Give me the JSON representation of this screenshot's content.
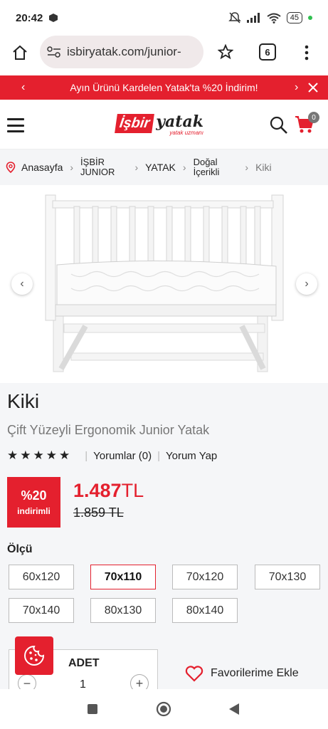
{
  "status": {
    "time": "20:42",
    "battery": "45"
  },
  "browser": {
    "url": "isbiryatak.com/junior-",
    "tab_count": "6"
  },
  "promo": {
    "text": "Ayın Ürünü Kardelen Yatak'ta %20 İndirim!"
  },
  "header": {
    "logo_left": "İşbir",
    "logo_right": "yatak",
    "logo_tagline": "yatak uzmanı",
    "cart_count": "0"
  },
  "breadcrumb": {
    "items": [
      {
        "label": "Anasayfa"
      },
      {
        "label_line1": "İŞBİR",
        "label_line2": "JUNIOR"
      },
      {
        "label": "YATAK"
      },
      {
        "label_line1": "Doğal",
        "label_line2": "İçerikli"
      },
      {
        "label": "Kiki"
      }
    ]
  },
  "product": {
    "title": "Kiki",
    "subtitle": "Çift Yüzeyli Ergonomik Junior Yatak",
    "rating_stars": 5,
    "reviews_label": "Yorumlar (0)",
    "write_review_label": "Yorum Yap",
    "discount_pct": "%20",
    "discount_label": "indirimli",
    "price": "1.487",
    "currency": "TL",
    "old_price": "1.859 TL"
  },
  "sizes": {
    "label": "Ölçü",
    "options": [
      "60x120",
      "70x110",
      "70x120",
      "70x130",
      "70x140",
      "80x130",
      "80x140"
    ],
    "selected": "70x110"
  },
  "quantity": {
    "label": "ADET",
    "value": "1"
  },
  "favorites": {
    "label": "Favorilerime Ekle"
  },
  "colors": {
    "brand_red": "#e4202e",
    "panel_bg": "#f5f6f8"
  }
}
